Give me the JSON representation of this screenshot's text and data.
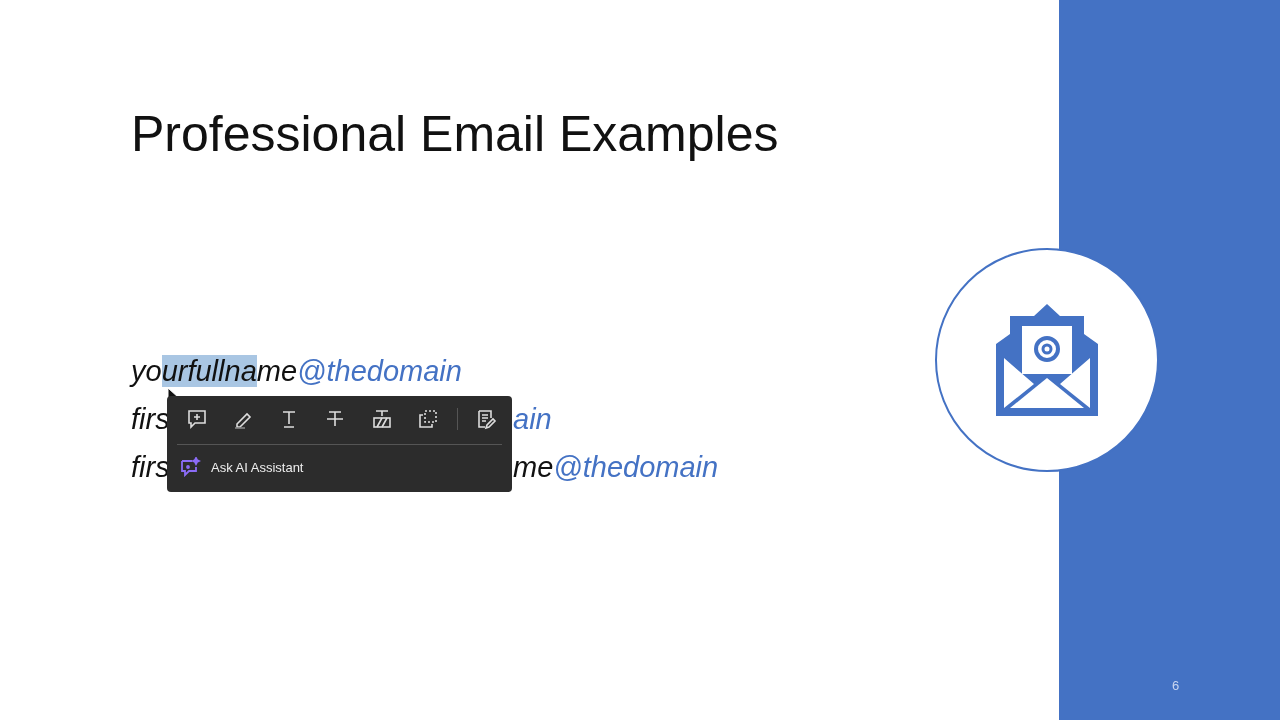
{
  "slide": {
    "title": "Professional Email Examples",
    "page_number": "6"
  },
  "lines": [
    {
      "before": "yo",
      "selected_text": "urfullna",
      "after": "me",
      "domain": "@thedomain"
    },
    {
      "before": "firs",
      "domain": "ain"
    },
    {
      "before": "firs",
      "after": "me",
      "domain": "@thedomain"
    }
  ],
  "popup": {
    "tools": [
      {
        "kind": "comment"
      },
      {
        "kind": "highlight"
      },
      {
        "kind": "underline"
      },
      {
        "kind": "strike"
      },
      {
        "kind": "replace"
      },
      {
        "kind": "copy"
      },
      {
        "kind": "edit"
      }
    ],
    "assistant": "Ask AI Assistant"
  }
}
